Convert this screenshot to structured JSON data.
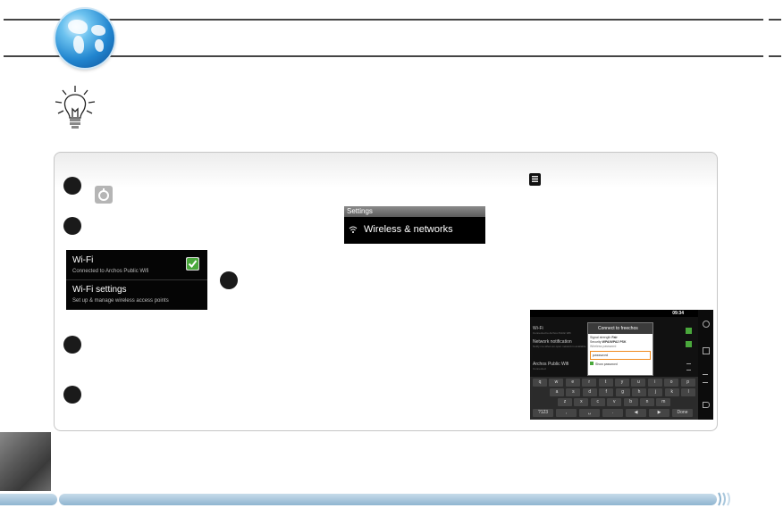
{
  "settings_screenshot": {
    "title": "Settings",
    "item": "Wireless & networks"
  },
  "wifi_screenshot": {
    "wifi_label": "Wi-Fi",
    "wifi_status": "Connected to Archos Public Wifi",
    "wifi_settings_label": "Wi-Fi settings",
    "wifi_settings_desc": "Set up & manage wireless access points"
  },
  "tablet_screenshot": {
    "time": "09:34",
    "list": [
      {
        "title": "Wi-Fi",
        "sub": "Connected to Archos Public Wifi"
      },
      {
        "title": "Network notification",
        "sub": "Notify me when an open network is available"
      },
      {
        "title": "Archos Public Wifi",
        "sub": "Connected"
      }
    ],
    "dialog": {
      "title": "Connect to freechos",
      "signal_label": "Signal strength",
      "signal_value": "Fair",
      "security_label": "Security",
      "security_value": "WPA/WPA2 PSK",
      "password_label": "Wireless password",
      "password_value": "password",
      "show_password": "Show password"
    },
    "keyboard": {
      "row1": [
        "q",
        "w",
        "e",
        "r",
        "t",
        "y",
        "u",
        "i",
        "o",
        "p"
      ],
      "row2": [
        "a",
        "s",
        "d",
        "f",
        "g",
        "h",
        "j",
        "k",
        "l"
      ],
      "row3": [
        "z",
        "x",
        "c",
        "v",
        "b",
        "n",
        "m"
      ],
      "row4": [
        "?123",
        ",",
        "␣",
        ".",
        "◀",
        "▶",
        "Done"
      ]
    }
  }
}
